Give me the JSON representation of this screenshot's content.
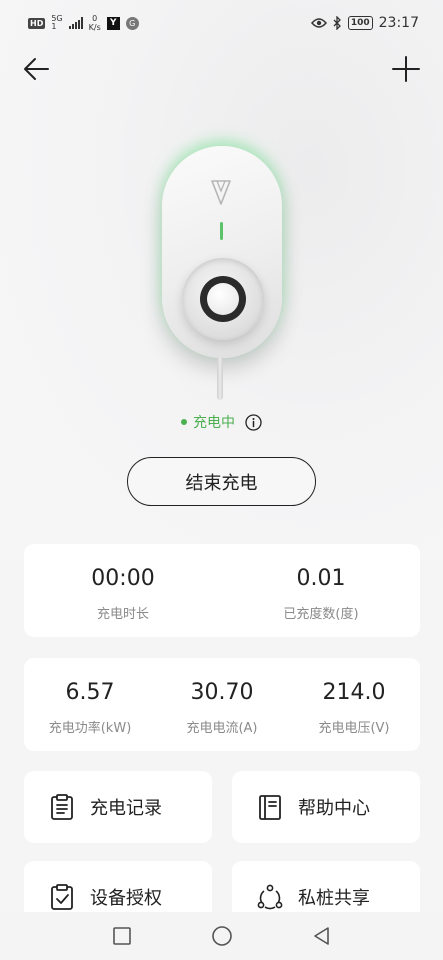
{
  "status_bar": {
    "hd": "HD",
    "signal_gen": "5G",
    "signal_sub": "1",
    "speed_value": "0",
    "speed_unit": "K/s",
    "app1": "Y",
    "app2": "G",
    "battery": "100",
    "time": "23:17"
  },
  "nav": {
    "back_icon": "arrow-left-icon",
    "add_icon": "plus-icon"
  },
  "charger": {
    "status_text": "充电中",
    "status_color": "#4caf50",
    "led_color": "#5cc36a"
  },
  "actions": {
    "end_label": "结束充电"
  },
  "stats_primary": [
    {
      "value": "00:00",
      "label": "充电时长"
    },
    {
      "value": "0.01",
      "label": "已充度数(度)"
    }
  ],
  "stats_secondary": [
    {
      "value": "6.57",
      "label": "充电功率(kW)"
    },
    {
      "value": "30.70",
      "label": "充电电流(A)"
    },
    {
      "value": "214.0",
      "label": "充电电压(V)"
    }
  ],
  "menu": [
    {
      "label": "充电记录",
      "icon": "clipboard-icon"
    },
    {
      "label": "帮助中心",
      "icon": "book-icon"
    },
    {
      "label": "设备授权",
      "icon": "clipboard-check-icon"
    },
    {
      "label": "私桩共享",
      "icon": "share-icon"
    }
  ]
}
